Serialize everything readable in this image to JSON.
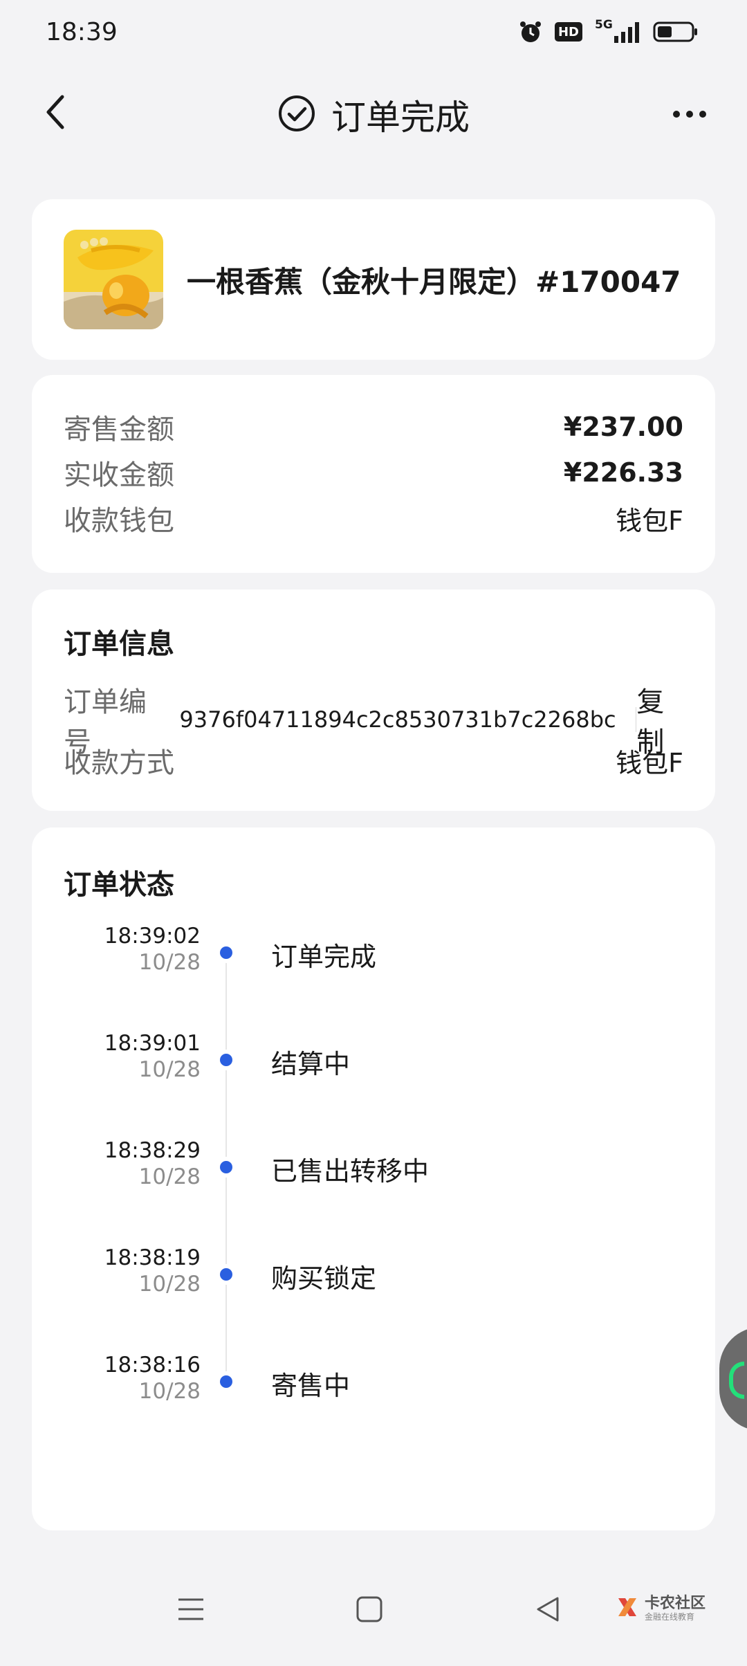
{
  "status_bar": {
    "time": "18:39",
    "icons": [
      "alarm-icon",
      "hd-icon",
      "5g-signal-icon",
      "battery-icon"
    ],
    "hd_text": "HD",
    "network_text": "5G"
  },
  "header": {
    "title": "订单完成",
    "title_icon": "check-circle-icon",
    "back_icon": "chevron-left-icon",
    "more_icon": "more-horizontal-icon"
  },
  "product": {
    "name": "一根香蕉（金秋十月限定）#170047"
  },
  "amounts": {
    "rows": [
      {
        "label": "寄售金额",
        "value": "¥237.00"
      },
      {
        "label": "实收金额",
        "value": "¥226.33"
      },
      {
        "label": "收款钱包",
        "value": "钱包F"
      }
    ]
  },
  "order_info": {
    "title": "订单信息",
    "order_no_label": "订单编号",
    "order_no": "9376f04711894c2c8530731b7c2268bc",
    "copy_label": "复制",
    "payment_label": "收款方式",
    "payment_value": "钱包F"
  },
  "order_status": {
    "title": "订单状态",
    "events": [
      {
        "time": "18:39:02",
        "date": "10/28",
        "label": "订单完成"
      },
      {
        "time": "18:39:01",
        "date": "10/28",
        "label": "结算中"
      },
      {
        "time": "18:38:29",
        "date": "10/28",
        "label": "已售出转移中"
      },
      {
        "time": "18:38:19",
        "date": "10/28",
        "label": "购买锁定"
      },
      {
        "time": "18:38:16",
        "date": "10/28",
        "label": "寄售中"
      }
    ]
  },
  "navbar": {
    "icons": [
      "menu-icon",
      "home-square-icon",
      "back-triangle-icon"
    ],
    "watermark_main": "卡农社区",
    "watermark_sub": "金融在线教育"
  },
  "colors": {
    "accent": "#2a5fe0",
    "background": "#f3f3f5",
    "card": "#ffffff",
    "muted_text": "#6b6b6b"
  }
}
